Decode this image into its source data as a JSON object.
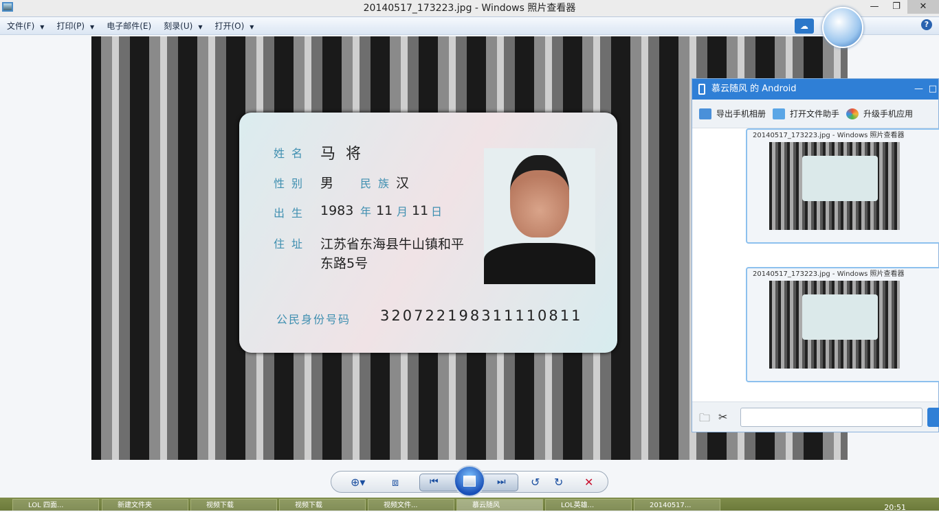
{
  "window": {
    "title": "20140517_173223.jpg - Windows 照片查看器",
    "minimize": "—",
    "maximize": "❐",
    "close": "✕"
  },
  "menu": [
    {
      "label": "文件(F)",
      "has_arrow": true
    },
    {
      "label": "打印(P)",
      "has_arrow": true
    },
    {
      "label": "电子邮件(E)",
      "has_arrow": false
    },
    {
      "label": "刻录(U)",
      "has_arrow": true
    },
    {
      "label": "打开(O)",
      "has_arrow": true
    }
  ],
  "help": "?",
  "card": {
    "name_label": "姓名",
    "name": "马 将",
    "sex_label": "性别",
    "sex": "男",
    "ethnic_label": "民族",
    "ethnic": "汉",
    "birth_label": "出生",
    "birth_year": "1983",
    "year": "年",
    "birth_month": "11",
    "month": "月",
    "birth_day": "11",
    "day": "日",
    "address_label": "住址",
    "address_line1": "江苏省东海县牛山镇和平",
    "address_line2": "东路5号",
    "id_label": "公民身份号码",
    "id_number": "320722198311110811"
  },
  "phone_panel": {
    "title": "慕云随风 的 Android",
    "tools": [
      {
        "label": "导出手机相册",
        "color": "#4a90d9"
      },
      {
        "label": "打开文件助手",
        "color": "#5aa6e6"
      },
      {
        "label": "升级手机应用",
        "color": "#e8543a"
      }
    ],
    "thumb_title": "20140517_173223.jpg - Windows 照片查看器"
  },
  "controls": {
    "zoom": "⊕▾",
    "fit": "⧈",
    "prev": "⏮",
    "next": "⏭",
    "rotate_ccw": "↺",
    "rotate_cw": "↻",
    "delete": "✕"
  },
  "taskbar": {
    "items": [
      {
        "label": "LOL 四面..."
      },
      {
        "label": "新建文件夹"
      },
      {
        "label": "视频下载"
      },
      {
        "label": "视频下载"
      },
      {
        "label": "视频文件..."
      },
      {
        "label": "慕云随风"
      },
      {
        "label": "LOL英雄..."
      },
      {
        "label": "20140517..."
      }
    ],
    "time": "20:51"
  }
}
